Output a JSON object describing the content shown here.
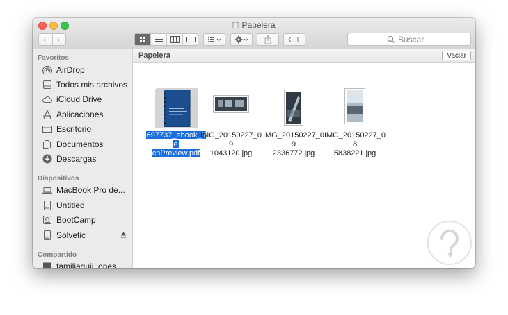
{
  "window": {
    "title": "Papelera"
  },
  "toolbar": {
    "search_placeholder": "Buscar"
  },
  "sidebar": {
    "favorites_header": "Favoritos",
    "favorites": [
      {
        "label": "AirDrop",
        "icon": "airdrop-icon"
      },
      {
        "label": "Todos mis archivos",
        "icon": "all-files-icon"
      },
      {
        "label": "iCloud Drive",
        "icon": "cloud-icon"
      },
      {
        "label": "Aplicaciones",
        "icon": "applications-icon"
      },
      {
        "label": "Escritorio",
        "icon": "desktop-icon"
      },
      {
        "label": "Documentos",
        "icon": "documents-icon"
      },
      {
        "label": "Descargas",
        "icon": "downloads-icon"
      }
    ],
    "devices_header": "Dispositivos",
    "devices": [
      {
        "label": "MacBook Pro de...",
        "icon": "laptop-icon"
      },
      {
        "label": "Untitled",
        "icon": "disk-icon"
      },
      {
        "label": "BootCamp",
        "icon": "disk-icon"
      },
      {
        "label": "Solvetic",
        "icon": "disk-icon",
        "ejectable": true
      }
    ],
    "shared_header": "Compartido",
    "shared": [
      {
        "label": "familiaguij_ones",
        "icon": "network-icon"
      }
    ]
  },
  "pathbar": {
    "title": "Papelera",
    "empty_button": "Vaciar"
  },
  "files": [
    {
      "name": "697737_ebook_TechPreview.pdf",
      "selected": true,
      "kind": "pdf",
      "lines": [
        "697737_ebook_Te",
        "chPreview.pdf"
      ]
    },
    {
      "name": "IMG_20150227_091043120.jpg",
      "selected": false,
      "kind": "landscape",
      "lines": [
        "IMG_20150227_09",
        "1043120.jpg"
      ]
    },
    {
      "name": "IMG_20150227_092336772.jpg",
      "selected": false,
      "kind": "portrait",
      "lines": [
        "IMG_20150227_09",
        "2336772.jpg"
      ]
    },
    {
      "name": "IMG_20150227_085838221.jpg",
      "selected": false,
      "kind": "portrait",
      "lines": [
        "IMG_20150227_08",
        "5838221.jpg"
      ]
    }
  ],
  "colors": {
    "selection": "#1a6fdc",
    "sidebar_bg": "#ebebeb"
  }
}
